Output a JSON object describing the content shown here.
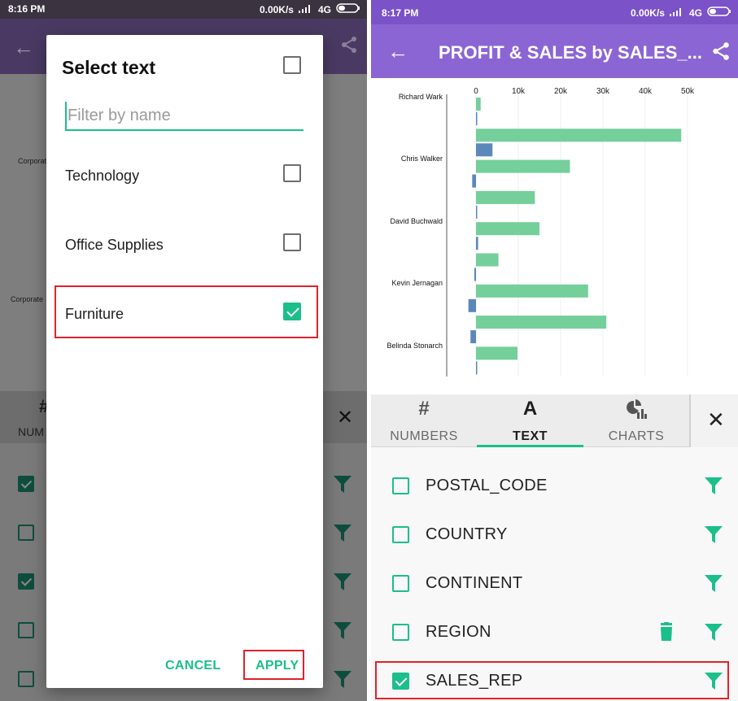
{
  "left": {
    "status": {
      "time": "8:16 PM",
      "network": "0.00K/s",
      "carrier": "4G"
    },
    "background": {
      "labels": [
        "Corporate",
        "Corporate"
      ],
      "tab_hash": "#",
      "tab_numbers_label": "NUM"
    },
    "background_rows": [
      {
        "checked": true
      },
      {
        "checked": false
      },
      {
        "checked": true
      },
      {
        "checked": false
      },
      {
        "checked": false
      }
    ],
    "dialog": {
      "title": "Select text",
      "select_all_checked": false,
      "filter_placeholder": "Filter by name",
      "filter_value": "",
      "items": [
        {
          "label": "Technology",
          "checked": false
        },
        {
          "label": "Office Supplies",
          "checked": false
        },
        {
          "label": "Furniture",
          "checked": true
        }
      ],
      "cancel_label": "CANCEL",
      "apply_label": "APPLY"
    }
  },
  "right": {
    "status": {
      "time": "8:17 PM",
      "network": "0.00K/s",
      "carrier": "4G"
    },
    "appbar": {
      "title": "PROFIT & SALES by SALES_..."
    },
    "colors": {
      "sales": "#74cf9b",
      "profit": "#5b88ba",
      "accent": "#1bbf8a",
      "appbar": "#8c65d4"
    },
    "chart_data": {
      "type": "bar",
      "orientation": "horizontal",
      "categories": [
        "Richard Wark",
        "Chris Walker",
        "David Buchwald",
        "Kevin Jernagan",
        "Belinda Stonarch"
      ],
      "x_ticks": [
        "0",
        "10k",
        "20k",
        "30k",
        "40k",
        "50k"
      ],
      "xlim": [
        -2000,
        52000
      ],
      "bar_groups": [
        {
          "sales": 1100,
          "profit": 180
        },
        {
          "sales": 48500,
          "profit": 3900
        },
        {
          "sales": 22200,
          "profit": -900
        },
        {
          "sales": 13900,
          "profit": 250
        },
        {
          "sales": 15000,
          "profit": 500
        },
        {
          "sales": 5300,
          "profit": -400
        },
        {
          "sales": 26500,
          "profit": -1800
        },
        {
          "sales": 30800,
          "profit": -1300
        },
        {
          "sales": 9800,
          "profit": 150
        }
      ],
      "grid": true
    },
    "tabs": [
      {
        "icon": "#",
        "label": "NUMBERS"
      },
      {
        "icon": "A",
        "label": "TEXT"
      },
      {
        "icon": "charts-icon",
        "label": "CHARTS"
      }
    ],
    "fields": [
      {
        "label": "POSTAL_CODE",
        "checked": false,
        "trash": false
      },
      {
        "label": "COUNTRY",
        "checked": false,
        "trash": false
      },
      {
        "label": "CONTINENT",
        "checked": false,
        "trash": false
      },
      {
        "label": "REGION",
        "checked": false,
        "trash": true
      },
      {
        "label": "SALES_REP",
        "checked": true,
        "trash": false
      }
    ]
  }
}
